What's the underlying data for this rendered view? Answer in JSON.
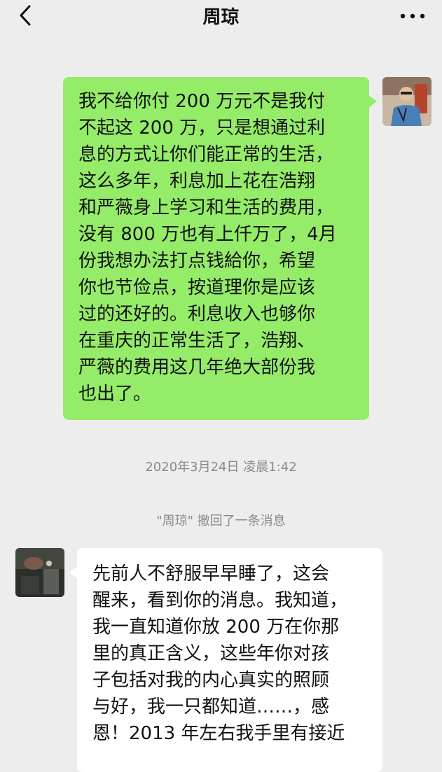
{
  "header": {
    "title": "周琼",
    "back_icon": "chevron-left-icon",
    "more_icon": "more-horizontal-icon"
  },
  "messages": [
    {
      "sender": "me",
      "text": "我不给你付 200 万元不是我付\n不起这 200 万，只是想通过利\n息的方式让你们能正常的生活，\n这么多年，利息加上花在浩翔\n和严薇身上学习和生活的费用，\n没有 800 万也有上仟万了，4月\n份我想办法打点钱給你，希望\n你也节俭点，按道理你是应该\n过的还好的。利息收入也够你\n在重庆的正常生活了，浩翔、\n严薇的费用这几年绝大部份我\n也出了。"
    },
    {
      "sender": "other",
      "text": "先前人不舒服早早睡了，这会\n醒来，看到你的消息。我知道，\n我一直知道你放 200 万在你那\n里的真正含义，这些年你对孩\n子包括对我的内心真实的照顾\n与好，我一只都知道……，感\n恩！2013 年左右我手里有接近"
    }
  ],
  "timestamp": "2020年3月24日 凌晨1:42",
  "recall_notice": "\"周琼\" 撤回了一条消息",
  "colors": {
    "background": "#ededed",
    "my_bubble": "#95ec69",
    "other_bubble": "#ffffff",
    "system_text": "#8a8a8a"
  }
}
